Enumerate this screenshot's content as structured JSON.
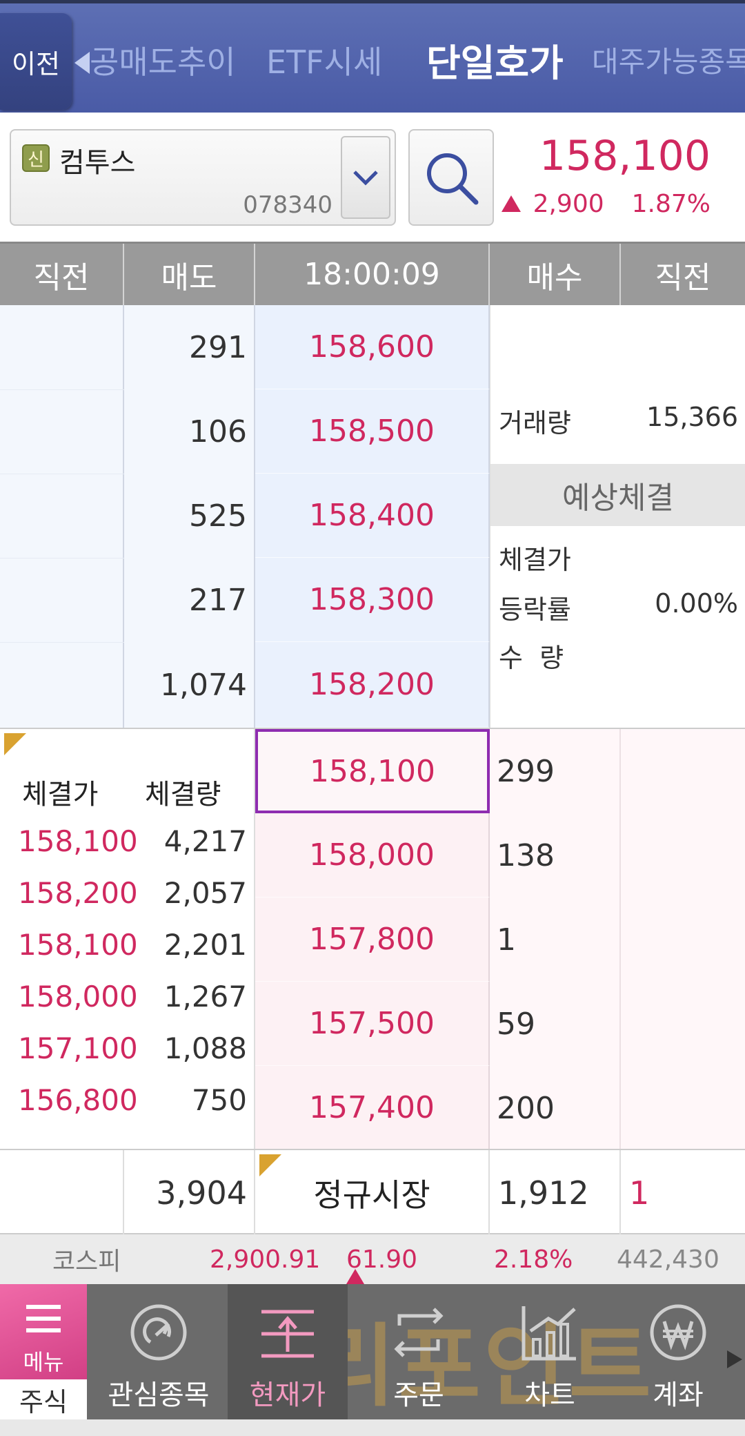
{
  "topbar": {
    "back_label": "이전",
    "tabs": [
      "공매도추이",
      "ETF시세",
      "단일호가",
      "대주가능종목"
    ],
    "active_tab": "단일호가"
  },
  "stock": {
    "badge": "신",
    "name": "컴투스",
    "code": "078340",
    "price": "158,100",
    "change": "2,900",
    "change_pct": "1.87%",
    "direction": "up"
  },
  "orderbook_header": [
    "직전",
    "매도",
    "18:00:09",
    "매수",
    "직전"
  ],
  "asks": [
    {
      "qty": "291",
      "price": "158,600"
    },
    {
      "qty": "106",
      "price": "158,500"
    },
    {
      "qty": "525",
      "price": "158,400"
    },
    {
      "qty": "217",
      "price": "158,300"
    },
    {
      "qty": "1,074",
      "price": "158,200"
    }
  ],
  "info": {
    "volume_label": "거래량",
    "volume_value": "15,366",
    "expected_title": "예상체결",
    "exec_price_label": "체결가",
    "exec_price_value": "",
    "rate_label": "등락률",
    "rate_value": "0.00%",
    "qty_label": "수  량",
    "qty_value": ""
  },
  "bids": [
    {
      "price": "158,100",
      "qty": "299",
      "current": true
    },
    {
      "price": "158,000",
      "qty": "138"
    },
    {
      "price": "157,800",
      "qty": "1"
    },
    {
      "price": "157,500",
      "qty": "59"
    },
    {
      "price": "157,400",
      "qty": "200"
    }
  ],
  "trades": {
    "price_header": "체결가",
    "volume_header": "체결량",
    "rows": [
      {
        "price": "158,100",
        "volume": "4,217"
      },
      {
        "price": "158,200",
        "volume": "2,057"
      },
      {
        "price": "158,100",
        "volume": "2,201"
      },
      {
        "price": "158,000",
        "volume": "1,267"
      },
      {
        "price": "157,100",
        "volume": "1,088"
      },
      {
        "price": "156,800",
        "volume": "750"
      }
    ]
  },
  "totals": {
    "ask_total": "3,904",
    "session": "정규시장",
    "bid_total": "1,912",
    "prev": "1"
  },
  "index": {
    "name": "코스피",
    "value": "2,900.91",
    "change": "61.90",
    "change_pct": "2.18%",
    "volume": "442,430"
  },
  "bottom_nav": {
    "menu_label": "메뉴",
    "section_label": "주식",
    "items": [
      "관심종목",
      "현재가",
      "주문",
      "차트",
      "계좌"
    ],
    "active": "현재가",
    "watermark": "렐리포인트"
  },
  "colors": {
    "up": "#d0285f",
    "topbar": "#4a5ba6",
    "highlight_border": "#8e2cb0"
  }
}
